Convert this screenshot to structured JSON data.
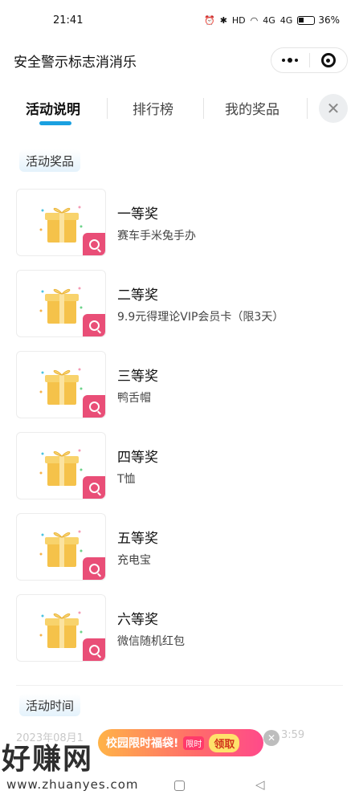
{
  "status_bar": {
    "time": "21:41",
    "network_label": "HD",
    "signal_1": "4G",
    "signal_2": "4G",
    "battery_percent": "36%"
  },
  "header": {
    "title": "安全警示标志消消乐"
  },
  "tabs": [
    {
      "label": "活动说明",
      "active": true
    },
    {
      "label": "排行榜",
      "active": false
    },
    {
      "label": "我的奖品",
      "active": false
    }
  ],
  "prizes_section": {
    "title": "活动奖品",
    "items": [
      {
        "level": "一等奖",
        "name": "赛车手米兔手办"
      },
      {
        "level": "二等奖",
        "name": "9.9元得理论VIP会员卡（限3天）"
      },
      {
        "level": "三等奖",
        "name": "鸭舌帽"
      },
      {
        "level": "四等奖",
        "name": "T恤"
      },
      {
        "level": "五等奖",
        "name": "充电宝"
      },
      {
        "level": "六等奖",
        "name": "微信随机红包"
      }
    ]
  },
  "time_section": {
    "title": "活动时间",
    "partial_start": "2023年08月1",
    "partial_end": "3:59"
  },
  "promo": {
    "text": "校园限时福袋!",
    "tag": "限时",
    "claim": "领取"
  },
  "watermark": {
    "text": "好赚网",
    "url": "www.zhuanyes.com"
  },
  "colors": {
    "accent_blue": "#1aa0e0",
    "badge_pink": "#e94e77",
    "gift_gold": "#f5c24a"
  }
}
